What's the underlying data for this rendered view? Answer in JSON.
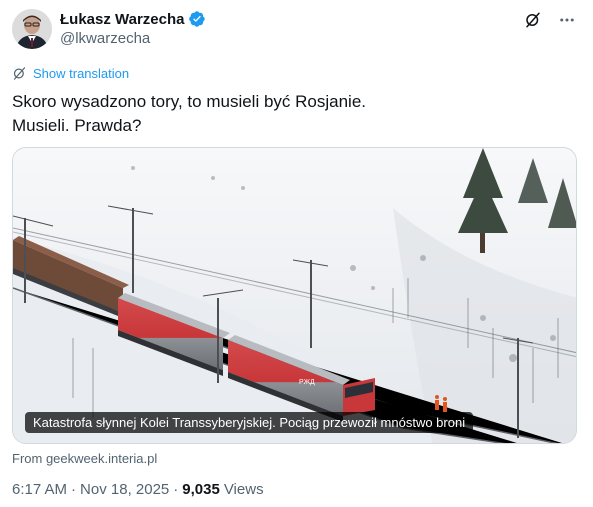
{
  "author": {
    "display_name": "Łukasz Warzecha",
    "handle": "@lkwarzecha",
    "verified_icon": "verified-badge-icon"
  },
  "actions": {
    "grok_icon": "grok-icon",
    "more_icon": "more-icon"
  },
  "translation": {
    "label": "Show translation"
  },
  "tweet": {
    "line1": "Skoro wysadzono tory, to musieli być Rosjanie.",
    "line2": "Musieli. Prawda?"
  },
  "media": {
    "caption": "Katastrofa słynnej Kolei Transsyberyjskiej. Pociąg przewoził mnóstwo broni",
    "locomotive_badge": "РЖД"
  },
  "source": {
    "text": "From geekweek.interia.pl"
  },
  "meta": {
    "time": "6:17 AM",
    "date": "Nov 18, 2025",
    "views_count": "9,035",
    "views_label": "Views"
  },
  "colors": {
    "accent": "#1d9bf0",
    "text": "#0f1419",
    "secondary": "#536471",
    "locomotive_red": "#c8373a"
  }
}
